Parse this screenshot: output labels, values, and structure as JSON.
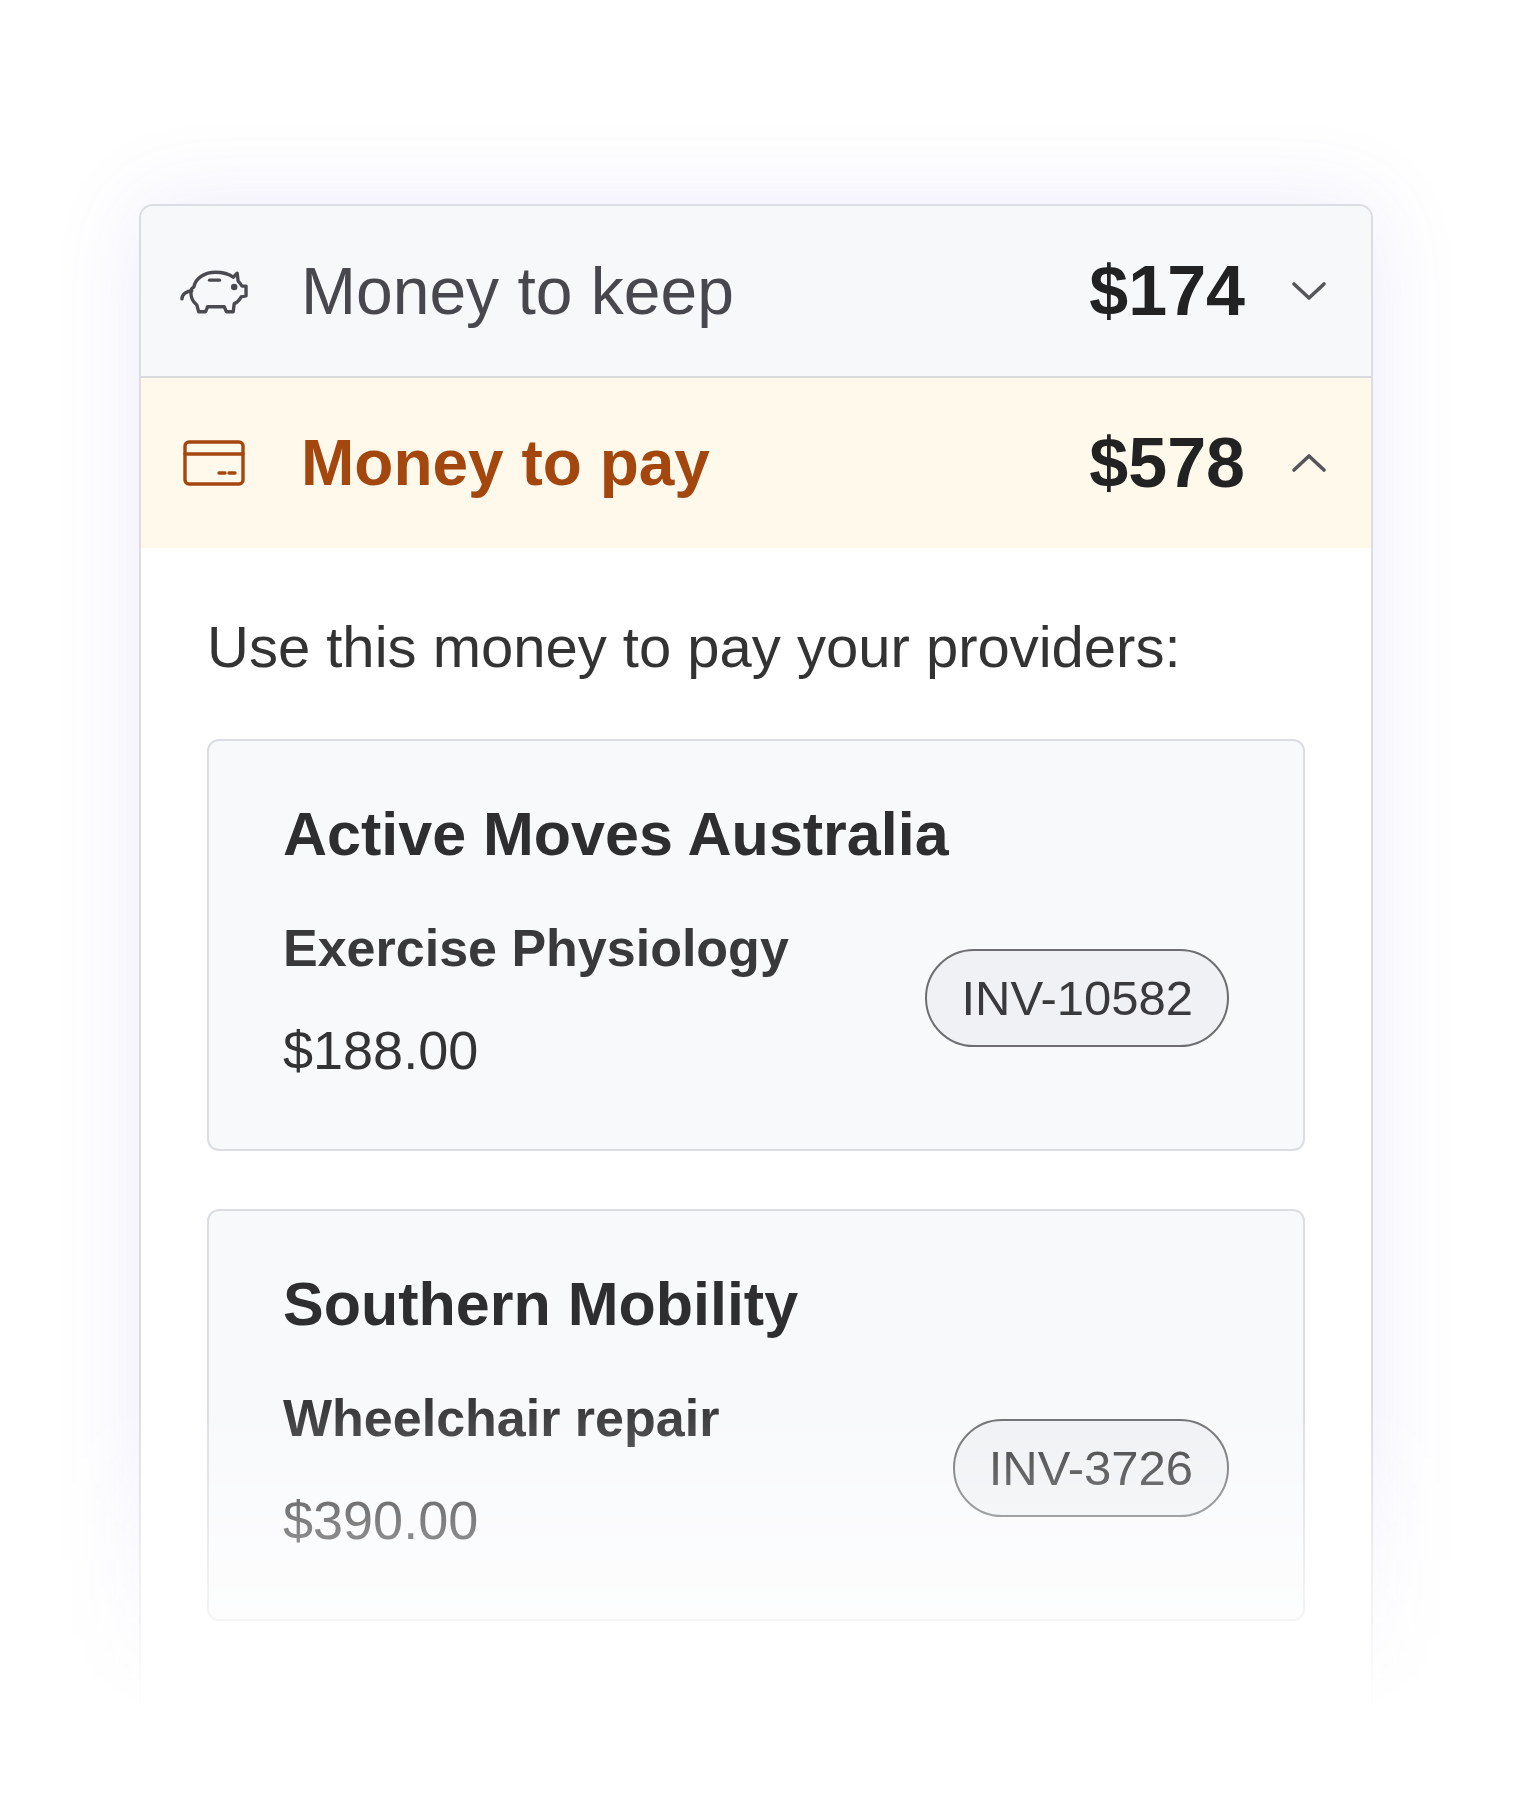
{
  "sections": [
    {
      "kind": "savings",
      "label": "Money to keep",
      "amount": "$174",
      "expanded": false
    },
    {
      "kind": "payments",
      "label": "Money to pay",
      "amount": "$578",
      "expanded": true,
      "description": "Use this money to pay your providers:",
      "providers": [
        {
          "name": "Active Moves Australia",
          "service": "Exercise Physiology",
          "amount": "$188.00",
          "invoice": "INV-10582"
        },
        {
          "name": "Southern Mobility",
          "service": "Wheelchair repair",
          "amount": "$390.00",
          "invoice": "INV-3726"
        }
      ]
    }
  ]
}
